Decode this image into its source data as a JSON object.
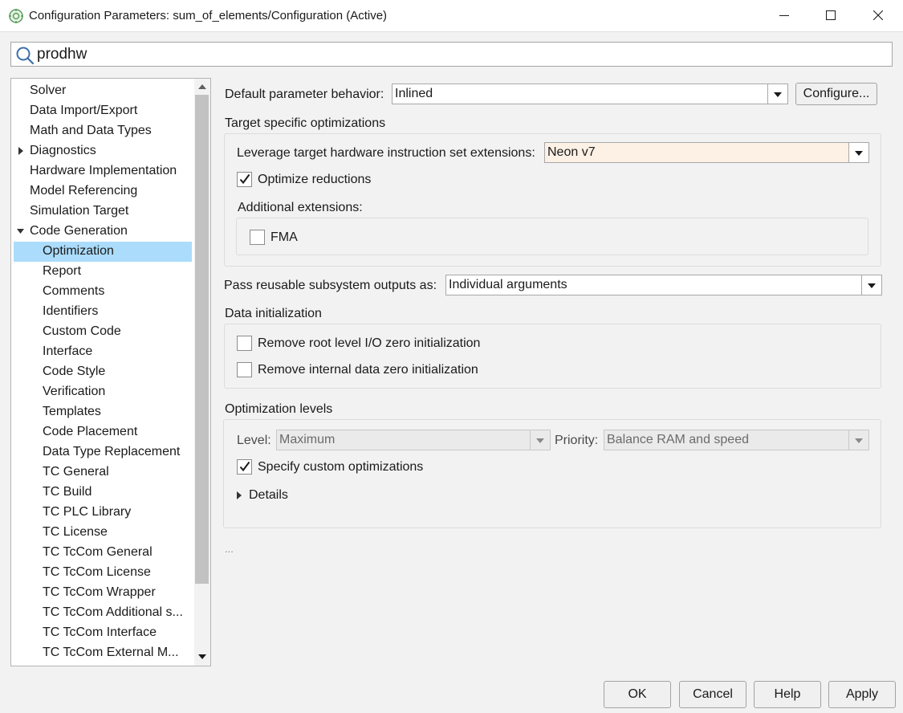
{
  "window": {
    "title": "Configuration Parameters: sum_of_elements/Configuration (Active)",
    "app_icon": "simulink-config-icon"
  },
  "search": {
    "value": "prodhw",
    "placeholder": ""
  },
  "tree": {
    "items": [
      {
        "label": "Solver"
      },
      {
        "label": "Data Import/Export"
      },
      {
        "label": "Math and Data Types"
      },
      {
        "label": "Diagnostics",
        "expander": "collapsed"
      },
      {
        "label": "Hardware Implementation"
      },
      {
        "label": "Model Referencing"
      },
      {
        "label": "Simulation Target"
      },
      {
        "label": "Code Generation",
        "expander": "expanded"
      },
      {
        "label": "Optimization",
        "selected": true
      },
      {
        "label": "Report"
      },
      {
        "label": "Comments"
      },
      {
        "label": "Identifiers"
      },
      {
        "label": "Custom Code"
      },
      {
        "label": "Interface"
      },
      {
        "label": "Code Style"
      },
      {
        "label": "Verification"
      },
      {
        "label": "Templates"
      },
      {
        "label": "Code Placement"
      },
      {
        "label": "Data Type Replacement"
      },
      {
        "label": "TC General"
      },
      {
        "label": "TC Build"
      },
      {
        "label": "TC PLC Library"
      },
      {
        "label": "TC License"
      },
      {
        "label": "TC TcCom General"
      },
      {
        "label": "TC TcCom License"
      },
      {
        "label": "TC TcCom Wrapper"
      },
      {
        "label": "TC TcCom Additional s..."
      },
      {
        "label": "TC TcCom Interface"
      },
      {
        "label": "TC TcCom External M..."
      }
    ]
  },
  "main": {
    "default_param": {
      "label": "Default parameter behavior:",
      "value": "Inlined",
      "configure_label": "Configure..."
    },
    "target_opt": {
      "title": "Target specific optimizations",
      "leverage_label": "Leverage target hardware instruction set extensions:",
      "leverage_value": "Neon v7",
      "optimize_reductions": {
        "label": "Optimize reductions",
        "checked": true
      },
      "additional_title": "Additional extensions:",
      "fma": {
        "label": "FMA",
        "checked": false
      }
    },
    "pass_reusable": {
      "label": "Pass reusable subsystem outputs as:",
      "value": "Individual arguments"
    },
    "data_init": {
      "title": "Data initialization",
      "remove_root": {
        "label": "Remove root level I/O zero initialization",
        "checked": false
      },
      "remove_internal": {
        "label": "Remove internal data zero initialization",
        "checked": false
      }
    },
    "opt_levels": {
      "title": "Optimization levels",
      "level_label": "Level:",
      "level_value": "Maximum",
      "priority_label": "Priority:",
      "priority_value": "Balance RAM and speed",
      "custom": {
        "label": "Specify custom optimizations",
        "checked": true
      },
      "details_label": "Details"
    },
    "ellipsis": "..."
  },
  "footer": {
    "ok": "OK",
    "cancel": "Cancel",
    "help": "Help",
    "apply": "Apply"
  },
  "colors": {
    "selection": "#abdcfb",
    "highlight_field": "#fdf1e6",
    "background": "#f2f2f2"
  }
}
